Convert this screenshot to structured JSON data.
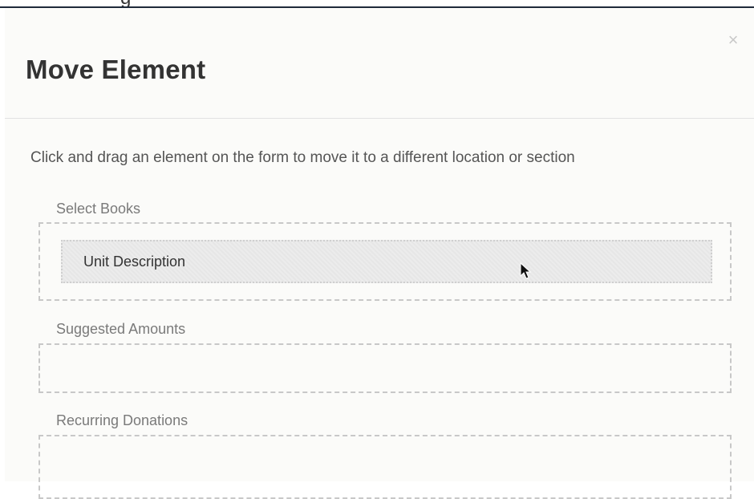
{
  "modal": {
    "title": "Move Element",
    "close_glyph": "×",
    "instruction": "Click and drag an element on the form to move it to a different location or section",
    "sections": [
      {
        "label": "Select Books",
        "elements": [
          "Unit Description"
        ]
      },
      {
        "label": "Suggested Amounts",
        "elements": []
      },
      {
        "label": "Recurring Donations",
        "elements": []
      }
    ]
  },
  "background_fragment": "g",
  "icons": {
    "close": "close-icon",
    "cursor": "mouse-pointer-icon"
  }
}
